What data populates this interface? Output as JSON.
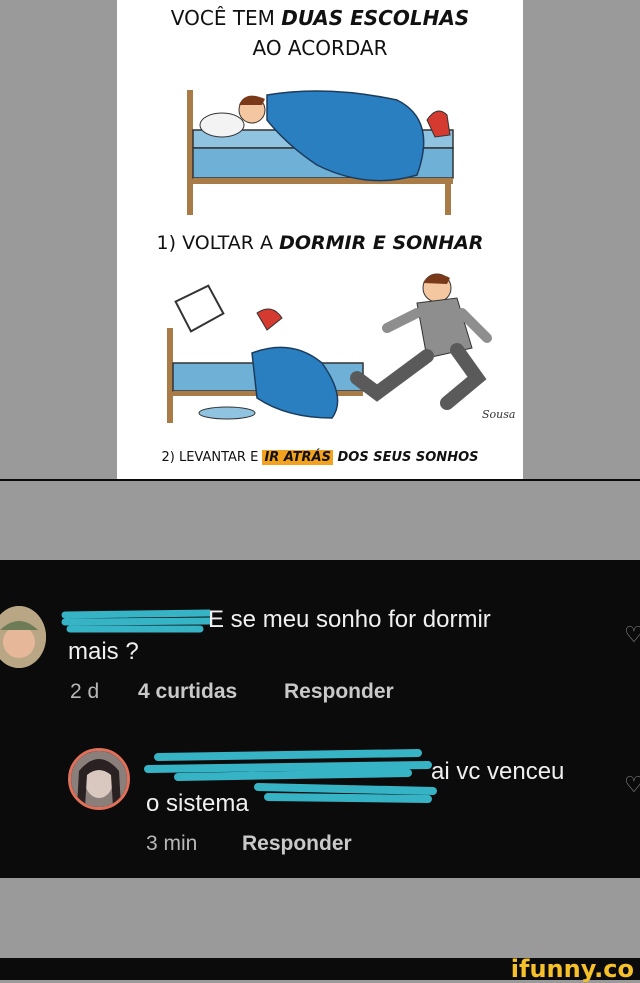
{
  "meme": {
    "title_line1_plain": "VOCÊ TEM ",
    "title_line1_bold": "DUAS ESCOLHAS",
    "title_line2": "AO ACORDAR",
    "choice1_plain": "1) VOLTAR A ",
    "choice1_bold": "DORMIR E SONHAR",
    "choice2_plain": "2) LEVANTAR E ",
    "choice2_highlight": "IR ATRÁS",
    "choice2_bold": " DOS SEUS SONHOS",
    "signature": "Sousa"
  },
  "comments": [
    {
      "username_visible": "E",
      "text_line1": " se meu sonho for dormir",
      "text_line2": "mais ?",
      "time": "2 d",
      "likes": "4 curtidas",
      "reply": "Responder"
    },
    {
      "username_visible": "",
      "text_line1": "ai vc venceu",
      "text_line2": "o sistema",
      "time": "3 min",
      "reply": "Responder"
    }
  ],
  "watermark": "ifunny.co",
  "colors": {
    "highlight": "#f3a21f",
    "blanket": "#2a7fc0",
    "scribble": "#37b3c6",
    "comment_bg": "#0b0b0b",
    "page_bg": "#9a9a9a"
  }
}
